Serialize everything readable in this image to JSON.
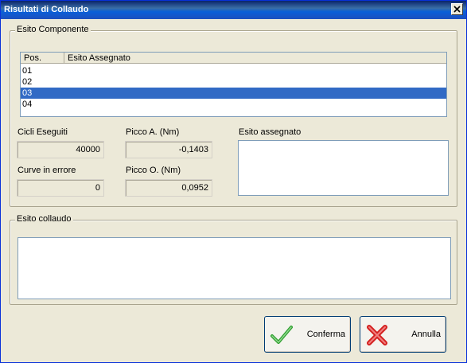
{
  "window": {
    "title": "Risultati di Collaudo"
  },
  "component_group": {
    "legend": "Esito Componente",
    "columns": [
      "Pos.",
      "Esito Assegnato"
    ],
    "rows": [
      {
        "pos": "01",
        "esito": ""
      },
      {
        "pos": "02",
        "esito": ""
      },
      {
        "pos": "03",
        "esito": ""
      },
      {
        "pos": "04",
        "esito": ""
      }
    ],
    "selected_row": "03",
    "cicli_label": "Cicli Eseguiti",
    "cicli_value": "40000",
    "curve_label": "Curve in errore",
    "curve_value": "0",
    "picco_a_label": "Picco A. (Nm)",
    "picco_a_value": "-0,1403",
    "picco_o_label": "Picco O. (Nm)",
    "picco_o_value": "0,0952",
    "esito_assegnato_label": "Esito assegnato",
    "esito_assegnato_value": ""
  },
  "collaudo_group": {
    "legend": "Esito collaudo",
    "value": ""
  },
  "buttons": {
    "confirm_label": "Conferma",
    "cancel_label": "Annulla"
  },
  "icons": {
    "close": "close-icon",
    "confirm": "checkmark-icon",
    "cancel": "red-x-icon"
  },
  "colors": {
    "title_bar": "#0A5FD8",
    "selection": "#316AC5",
    "confirm_icon": "#2E9E2E",
    "cancel_icon": "#D42020"
  }
}
